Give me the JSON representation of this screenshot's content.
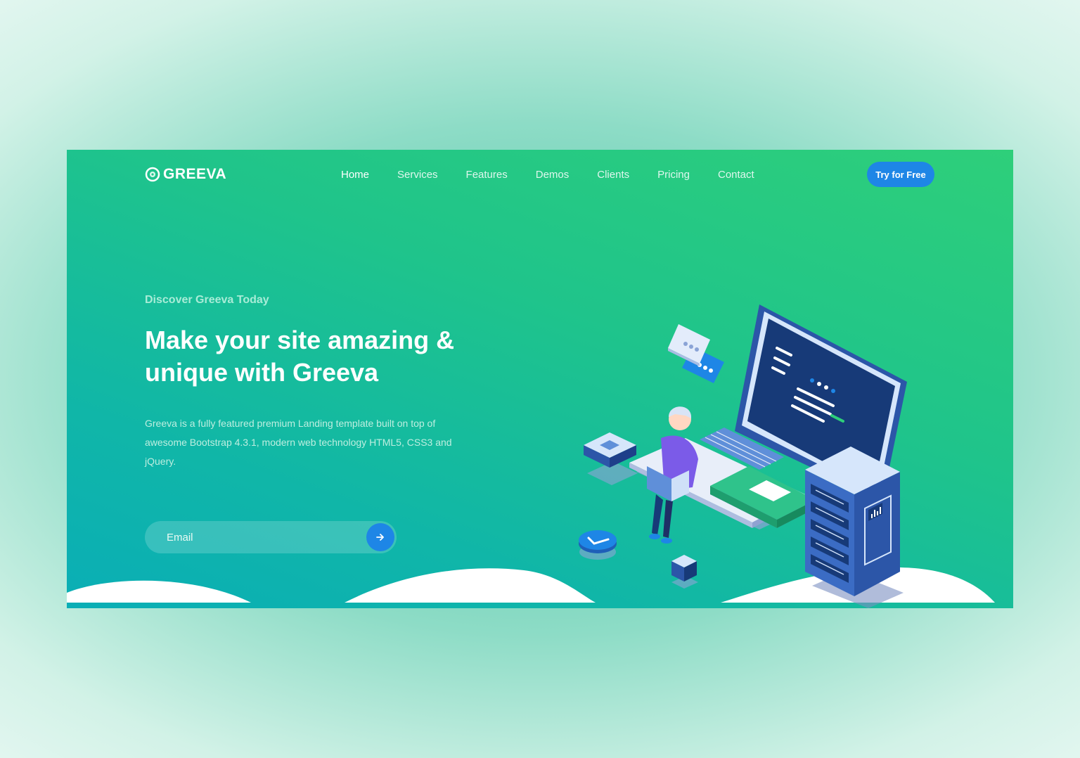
{
  "brand": {
    "name": "GREEVA",
    "logo_icon": "ring-logo-icon"
  },
  "nav": {
    "items": [
      {
        "label": "Home",
        "active": true
      },
      {
        "label": "Services",
        "active": false
      },
      {
        "label": "Features",
        "active": false
      },
      {
        "label": "Demos",
        "active": false
      },
      {
        "label": "Clients",
        "active": false
      },
      {
        "label": "Pricing",
        "active": false
      },
      {
        "label": "Contact",
        "active": false
      }
    ],
    "cta_label": "Try for Free"
  },
  "hero": {
    "kicker": "Discover Greeva Today",
    "headline": "Make your site amazing & unique with Greeva",
    "description": "Greeva is a fully featured premium Landing template built on top of awesome Bootstrap 4.3.1, modern web technology HTML5, CSS3 and jQuery.",
    "email_placeholder": "Email",
    "submit_icon": "arrow-right-icon"
  },
  "colors": {
    "gradient_top": "#2ecf7a",
    "gradient_bottom": "#0aaeb6",
    "accent_blue": "#1e86e6",
    "navy": "#173a78",
    "white": "#ffffff"
  }
}
